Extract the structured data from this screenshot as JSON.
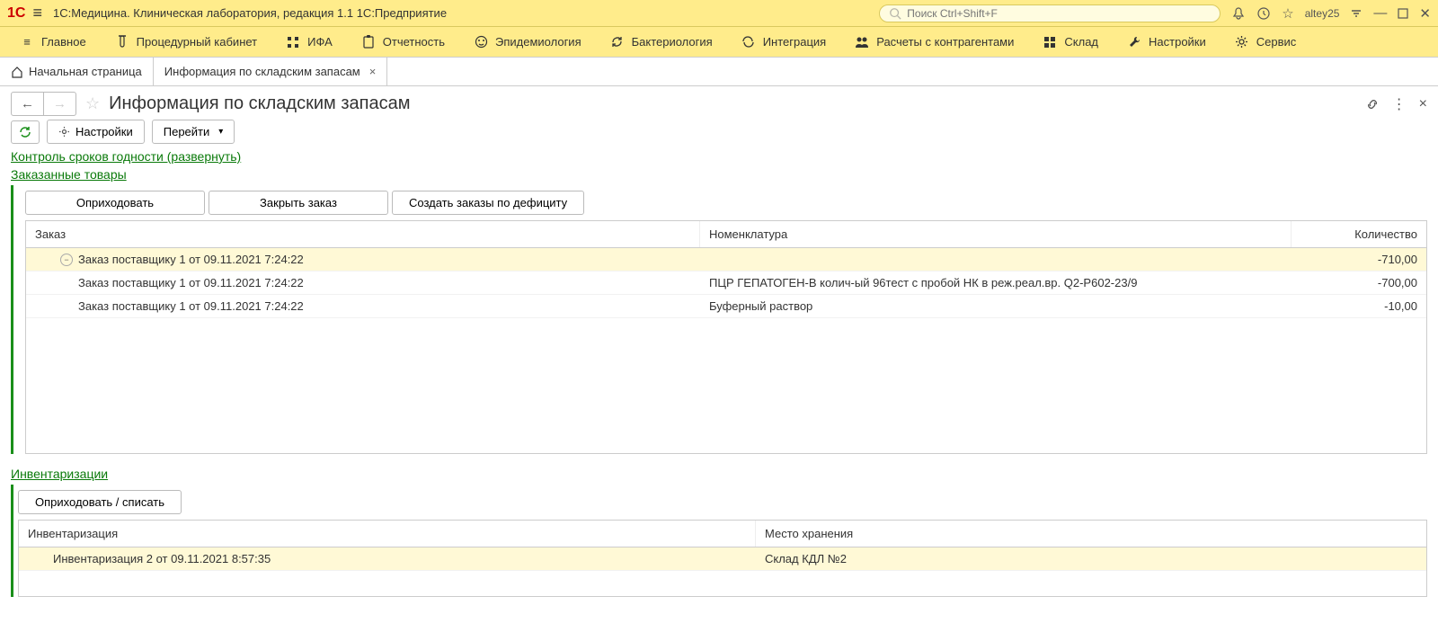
{
  "titlebar": {
    "logo": "1C",
    "app_title": "1С:Медицина. Клиническая лаборатория, редакция 1.1 1С:Предприятие",
    "search_placeholder": "Поиск Ctrl+Shift+F",
    "user": "altey25"
  },
  "menubar": {
    "items": [
      {
        "label": "Главное",
        "icon": "menu"
      },
      {
        "label": "Процедурный кабинет",
        "icon": "tube"
      },
      {
        "label": "ИФА",
        "icon": "grid"
      },
      {
        "label": "Отчетность",
        "icon": "clipboard"
      },
      {
        "label": "Эпидемиология",
        "icon": "smile"
      },
      {
        "label": "Бактериология",
        "icon": "refresh"
      },
      {
        "label": "Интеграция",
        "icon": "sync"
      },
      {
        "label": "Расчеты с контрагентами",
        "icon": "users"
      },
      {
        "label": "Склад",
        "icon": "blocks"
      },
      {
        "label": "Настройки",
        "icon": "wrench"
      },
      {
        "label": "Сервис",
        "icon": "gear"
      }
    ]
  },
  "tabs": {
    "home": "Начальная страница",
    "active": "Информация по складским запасам"
  },
  "page": {
    "title": "Информация по складским запасам",
    "btn_settings": "Настройки",
    "btn_goto": "Перейти",
    "link_expiry": "Контроль сроков годности (развернуть)"
  },
  "ordered": {
    "title": "Заказанные товары",
    "btn_receive": "Оприходовать",
    "btn_close": "Закрыть заказ",
    "btn_create": "Создать заказы по дефициту",
    "headers": {
      "order": "Заказ",
      "nomen": "Номенклатура",
      "qty": "Количество"
    },
    "parent": {
      "label": "Заказ поставщику 1 от 09.11.2021 7:24:22",
      "qty": "-710,00"
    },
    "rows": [
      {
        "order": "Заказ поставщику 1 от 09.11.2021 7:24:22",
        "nomen": "ПЦР ГЕПАТОГЕН-В колич-ый 96тест с пробой НК в реж.реал.вр. Q2-P602-23/9",
        "qty": "-700,00"
      },
      {
        "order": "Заказ поставщику 1 от 09.11.2021 7:24:22",
        "nomen": "Буферный раствор",
        "qty": "-10,00"
      }
    ]
  },
  "inventory": {
    "title": "Инвентаризации",
    "btn_action": "Оприходовать / списать",
    "headers": {
      "inv": "Инвентаризация",
      "loc": "Место хранения"
    },
    "rows": [
      {
        "inv": "Инвентаризация 2 от 09.11.2021 8:57:35",
        "loc": "Склад КДЛ №2"
      }
    ]
  }
}
